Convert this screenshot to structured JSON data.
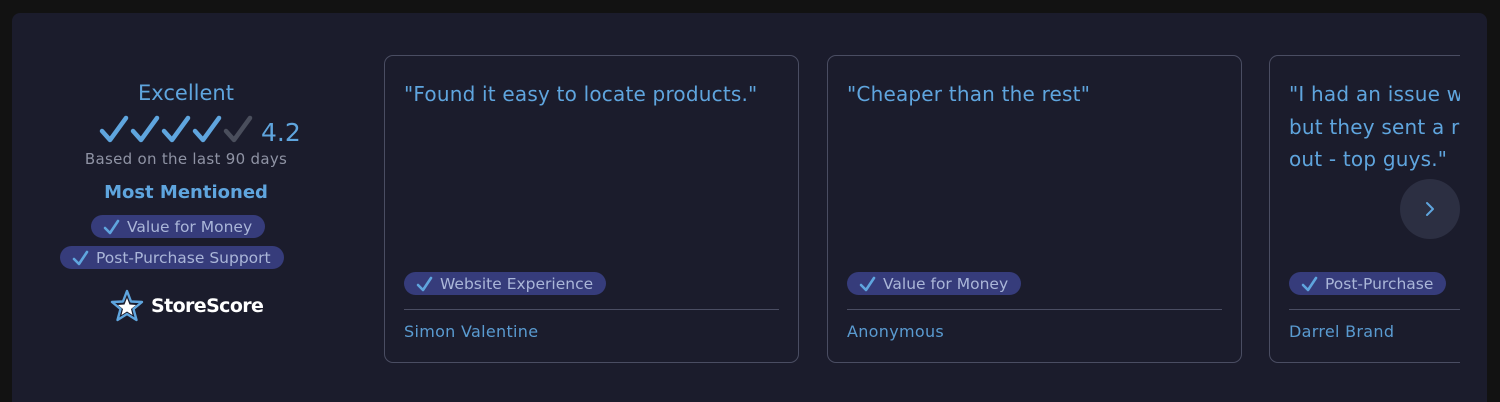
{
  "summary": {
    "rating_word": "Excellent",
    "score": "4.2",
    "stars": {
      "filled": 4,
      "total": 5
    },
    "period": "Based on the last 90 days",
    "most_mentioned_title": "Most Mentioned",
    "most_mentioned": [
      "Value for Money",
      "Post-Purchase Support"
    ],
    "brand_name": "StoreScore"
  },
  "reviews": [
    {
      "quote": "\"Found it easy to locate products.\"",
      "tag": "Website Experience",
      "author": "Simon Valentine"
    },
    {
      "quote": "\"Cheaper than the rest\"",
      "tag": "Value for Money",
      "author": "Anonymous"
    },
    {
      "quote": "\"I had an issue w\nbut they sent a r\nout - top guys.\"",
      "tag": "Post-Purchase",
      "author": "Darrel Brand"
    }
  ],
  "icons": {
    "star": "check-icon",
    "tag": "check-icon",
    "logo": "star-logo-icon",
    "next": "chevron-right-icon"
  },
  "colors": {
    "background": "#121212",
    "panel": "#1b1c2c",
    "accent": "#5fa5de",
    "pill": "#363c7b",
    "star_empty": "#4a4e5c",
    "next_button": "#2c2f42"
  }
}
